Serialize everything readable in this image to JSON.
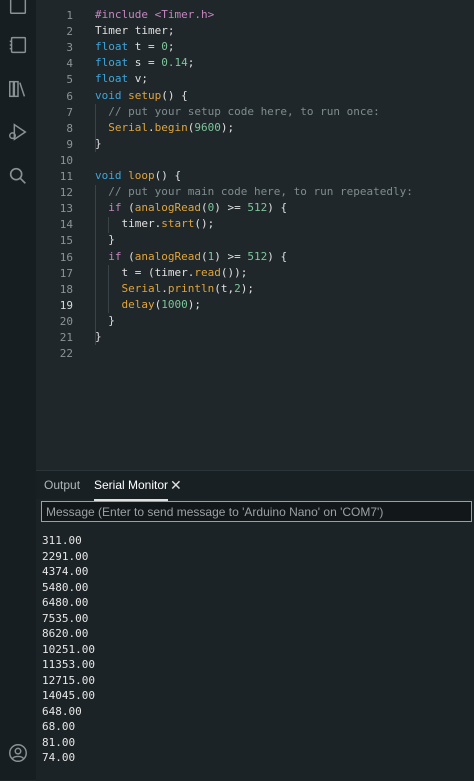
{
  "activity_bar": {
    "icons": [
      "sketchbook-icon",
      "boards-manager-icon",
      "library-manager-icon",
      "debug-icon",
      "search-icon",
      "account-icon"
    ]
  },
  "editor": {
    "line_numbers": [
      "1",
      "2",
      "3",
      "4",
      "5",
      "6",
      "7",
      "8",
      "9",
      "10",
      "11",
      "12",
      "13",
      "14",
      "15",
      "16",
      "17",
      "18",
      "19",
      "20",
      "21",
      "22"
    ],
    "active_line": "19",
    "lines": [
      [
        {
          "t": "#include <Timer.h>",
          "c": "kw"
        }
      ],
      [
        {
          "t": "Timer timer;",
          "c": "br"
        }
      ],
      [
        {
          "t": "float",
          "c": "ty"
        },
        {
          "t": " t = ",
          "c": "br"
        },
        {
          "t": "0",
          "c": "num"
        },
        {
          "t": ";",
          "c": "br"
        }
      ],
      [
        {
          "t": "float",
          "c": "ty"
        },
        {
          "t": " s = ",
          "c": "br"
        },
        {
          "t": "0.14",
          "c": "num"
        },
        {
          "t": ";",
          "c": "br"
        }
      ],
      [
        {
          "t": "float",
          "c": "ty"
        },
        {
          "t": " v;",
          "c": "br"
        }
      ],
      [
        {
          "t": "void",
          "c": "ty"
        },
        {
          "t": " ",
          "c": "br"
        },
        {
          "t": "setup",
          "c": "fn"
        },
        {
          "t": "() {",
          "c": "br"
        }
      ],
      [
        {
          "t": "  // put your setup code here, to run once:",
          "c": "cm"
        }
      ],
      [
        {
          "t": "  ",
          "c": "br"
        },
        {
          "t": "Serial",
          "c": "fn"
        },
        {
          "t": ".",
          "c": "br"
        },
        {
          "t": "begin",
          "c": "fn"
        },
        {
          "t": "(",
          "c": "br"
        },
        {
          "t": "9600",
          "c": "num"
        },
        {
          "t": ");",
          "c": "br"
        }
      ],
      [
        {
          "t": "}",
          "c": "br"
        }
      ],
      [],
      [
        {
          "t": "void",
          "c": "ty"
        },
        {
          "t": " ",
          "c": "br"
        },
        {
          "t": "loop",
          "c": "fn"
        },
        {
          "t": "() {",
          "c": "br"
        }
      ],
      [
        {
          "t": "  // put your main code here, to run repeatedly:",
          "c": "cm"
        }
      ],
      [
        {
          "t": "  ",
          "c": "br"
        },
        {
          "t": "if",
          "c": "kw"
        },
        {
          "t": " (",
          "c": "br"
        },
        {
          "t": "analogRead",
          "c": "fn"
        },
        {
          "t": "(",
          "c": "br"
        },
        {
          "t": "0",
          "c": "num"
        },
        {
          "t": ") >= ",
          "c": "br"
        },
        {
          "t": "512",
          "c": "num"
        },
        {
          "t": ") {",
          "c": "br"
        }
      ],
      [
        {
          "t": "    timer.",
          "c": "br"
        },
        {
          "t": "start",
          "c": "fn"
        },
        {
          "t": "();",
          "c": "br"
        }
      ],
      [
        {
          "t": "  }",
          "c": "br"
        }
      ],
      [
        {
          "t": "  ",
          "c": "br"
        },
        {
          "t": "if",
          "c": "kw"
        },
        {
          "t": " (",
          "c": "br"
        },
        {
          "t": "analogRead",
          "c": "fn"
        },
        {
          "t": "(",
          "c": "br"
        },
        {
          "t": "1",
          "c": "num"
        },
        {
          "t": ") >= ",
          "c": "br"
        },
        {
          "t": "512",
          "c": "num"
        },
        {
          "t": ") {",
          "c": "br"
        }
      ],
      [
        {
          "t": "    t = (timer.",
          "c": "br"
        },
        {
          "t": "read",
          "c": "fn"
        },
        {
          "t": "());",
          "c": "br"
        }
      ],
      [
        {
          "t": "    ",
          "c": "br"
        },
        {
          "t": "Serial",
          "c": "fn"
        },
        {
          "t": ".",
          "c": "br"
        },
        {
          "t": "println",
          "c": "fn"
        },
        {
          "t": "(t,",
          "c": "br"
        },
        {
          "t": "2",
          "c": "num"
        },
        {
          "t": ");",
          "c": "br"
        }
      ],
      [
        {
          "t": "    ",
          "c": "br"
        },
        {
          "t": "delay",
          "c": "fn"
        },
        {
          "t": "(",
          "c": "br"
        },
        {
          "t": "1000",
          "c": "num"
        },
        {
          "t": ");",
          "c": "br"
        }
      ],
      [
        {
          "t": "  }",
          "c": "br"
        }
      ],
      [
        {
          "t": "}",
          "c": "br"
        }
      ],
      []
    ]
  },
  "panel": {
    "tab_output": "Output",
    "tab_serial": "Serial Monitor",
    "close_glyph": "✕",
    "message_placeholder": "Message (Enter to send message to 'Arduino Nano' on 'COM7')",
    "output_lines": [
      "311.00",
      "2291.00",
      "4374.00",
      "5480.00",
      "6480.00",
      "7535.00",
      "8620.00",
      "10251.00",
      "11353.00",
      "12715.00",
      "14045.00",
      "648.00",
      "68.00",
      "81.00",
      "74.00"
    ]
  },
  "colors": {
    "background": "#1f272a",
    "keyword": "#c586c0",
    "type": "#3fa6db",
    "function": "#e0a43c",
    "number": "#7ec699",
    "comment": "#7f8c8d"
  }
}
